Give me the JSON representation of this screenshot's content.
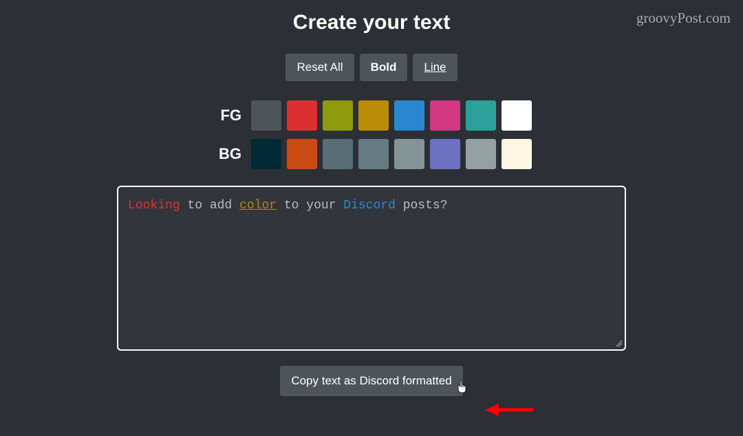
{
  "watermark": "groovyPost.com",
  "header": {
    "title": "Create your text"
  },
  "toolbar": {
    "reset_label": "Reset All",
    "bold_label": "Bold",
    "line_label": "Line"
  },
  "fg": {
    "label": "FG",
    "colors": [
      "#4f535a",
      "#dc3030",
      "#8f9a0c",
      "#bb8c07",
      "#2b86d0",
      "#d33682",
      "#2aa198",
      "#ffffff"
    ]
  },
  "bg": {
    "label": "BG",
    "colors": [
      "#002b36",
      "#cb4b16",
      "#586e75",
      "#657b83",
      "#839496",
      "#6c71c4",
      "#93a1a1",
      "#fdf6e3"
    ]
  },
  "editor": {
    "segments": [
      {
        "text": "Looking",
        "style": "seg-red"
      },
      {
        "text": " to add ",
        "style": "seg-gray"
      },
      {
        "text": "color",
        "style": "seg-yellow"
      },
      {
        "text": " to your ",
        "style": "seg-gray"
      },
      {
        "text": "Discord",
        "style": "seg-blue"
      },
      {
        "text": " posts?",
        "style": "seg-gray"
      }
    ]
  },
  "copy": {
    "label": "Copy text as Discord formatted"
  }
}
